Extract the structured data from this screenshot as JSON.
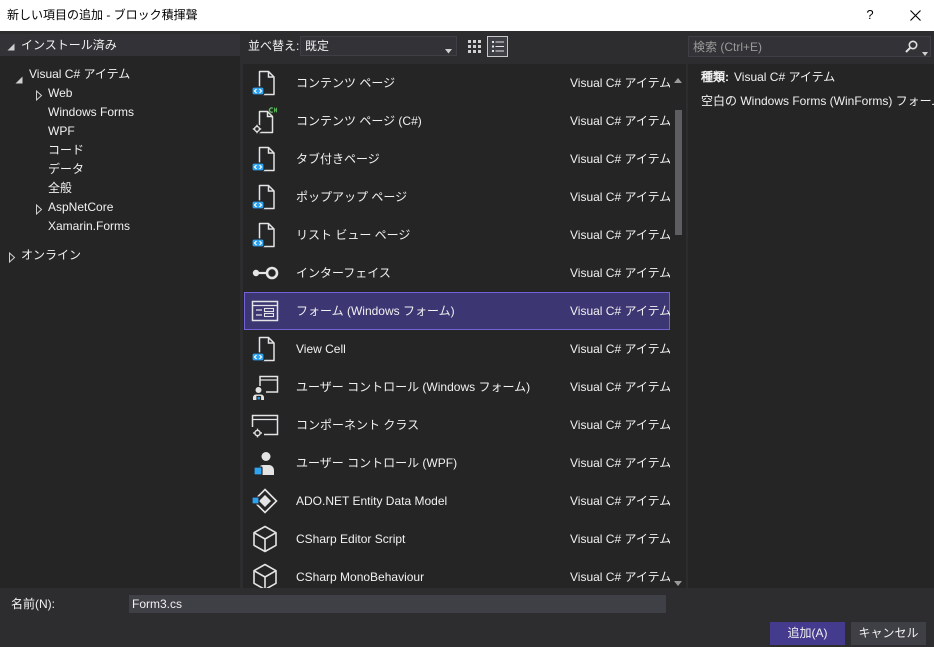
{
  "window": {
    "title": "新しい項目の追加 - ブロック積揮聲",
    "help_label": "?"
  },
  "sidebar": {
    "categories": [
      {
        "label": "インストール済み",
        "expander": "expanded",
        "children": [
          {
            "label": "Visual C# アイテム",
            "expander": "expanded",
            "children": [
              {
                "label": "Web",
                "expander": "collapsed"
              },
              {
                "label": "Windows Forms"
              },
              {
                "label": "WPF"
              },
              {
                "label": "コード"
              },
              {
                "label": "データ"
              },
              {
                "label": "全般"
              },
              {
                "label": "AspNetCore",
                "expander": "collapsed"
              },
              {
                "label": "Xamarin.Forms"
              }
            ]
          }
        ]
      },
      {
        "label": "オンライン",
        "expander": "collapsed"
      }
    ]
  },
  "toolbar": {
    "sort_label": "並べ替え:",
    "sort_value": "既定",
    "view_mode": "list"
  },
  "templates": [
    {
      "name": "コンテンツ ページ",
      "type": "Visual C# アイテム",
      "icon": "page-icon"
    },
    {
      "name": "コンテンツ ページ (C#)",
      "type": "Visual C# アイテム",
      "icon": "csharp-page-icon"
    },
    {
      "name": "タブ付きページ",
      "type": "Visual C# アイテム",
      "icon": "page-icon"
    },
    {
      "name": "ポップアップ ページ",
      "type": "Visual C# アイテム",
      "icon": "page-icon"
    },
    {
      "name": "リスト ビュー ページ",
      "type": "Visual C# アイテム",
      "icon": "page-icon"
    },
    {
      "name": "インターフェイス",
      "type": "Visual C# アイテム",
      "icon": "interface-icon"
    },
    {
      "name": "フォーム (Windows フォーム)",
      "type": "Visual C# アイテム",
      "icon": "form-icon",
      "selected": true
    },
    {
      "name": "View Cell",
      "type": "Visual C# アイテム",
      "icon": "page-icon"
    },
    {
      "name": "ユーザー コントロール (Windows フォーム)",
      "type": "Visual C# アイテム",
      "icon": "user-control-icon"
    },
    {
      "name": "コンポーネント クラス",
      "type": "Visual C# アイテム",
      "icon": "component-icon"
    },
    {
      "name": "ユーザー コントロール (WPF)",
      "type": "Visual C# アイテム",
      "icon": "wpf-user-control-icon"
    },
    {
      "name": "ADO.NET Entity Data Model",
      "type": "Visual C# アイテム",
      "icon": "entity-model-icon"
    },
    {
      "name": "CSharp Editor Script",
      "type": "Visual C# アイテム",
      "icon": "unity-script-icon"
    },
    {
      "name": "CSharp MonoBehaviour",
      "type": "Visual C# アイテム",
      "icon": "unity-script-icon"
    }
  ],
  "search": {
    "placeholder": "検索 (Ctrl+E)"
  },
  "details": {
    "type_label": "種類:",
    "type_value": "Visual C# アイテム",
    "description": "空白の Windows Forms (WinForms) フォーム"
  },
  "footer": {
    "name_label": "名前(N):",
    "name_value": "Form3.cs",
    "add_label": "追加(A)",
    "cancel_label": "キャンセル"
  },
  "colors": {
    "selection_background": "#3c3673",
    "selection_border": "#7262d6",
    "primary_button": "#443b8f",
    "icon_badge_blue": "#2ea3f2",
    "csharp_green": "#5ec45e"
  }
}
